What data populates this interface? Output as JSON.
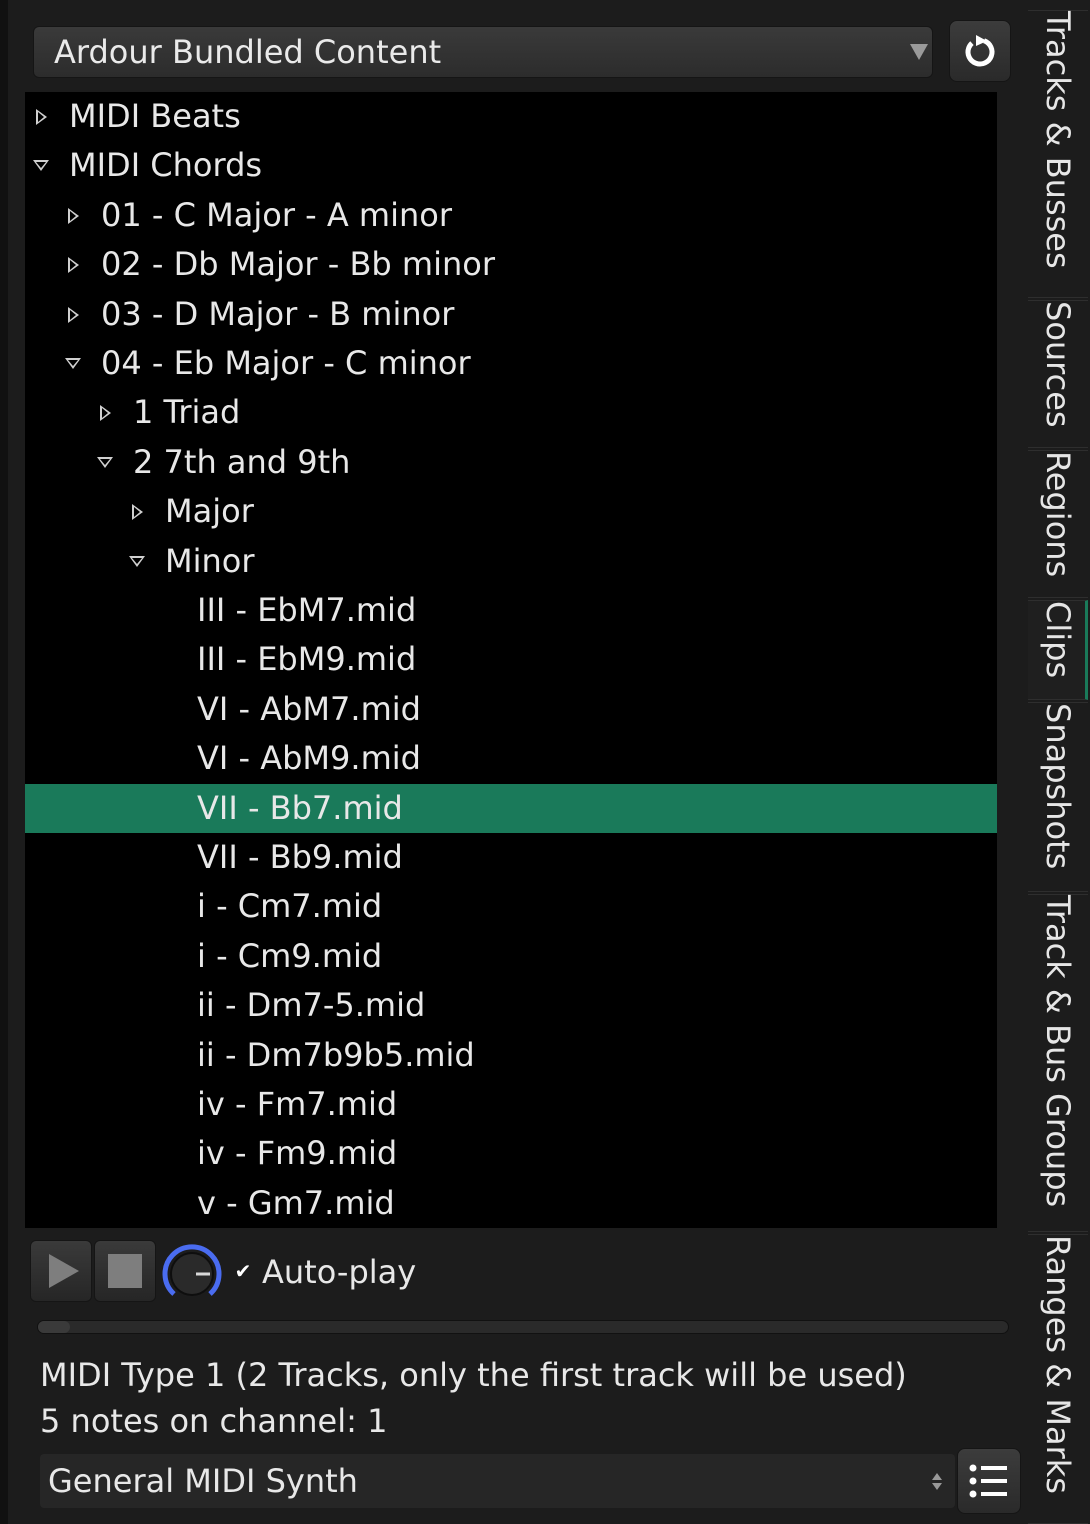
{
  "source_selector": {
    "value": "Ardour Bundled Content"
  },
  "tree": [
    {
      "label": "MIDI Beats",
      "level": 0,
      "expander": "collapsed"
    },
    {
      "label": "MIDI Chords",
      "level": 0,
      "expander": "expanded"
    },
    {
      "label": "01 - C Major - A minor",
      "level": 1,
      "expander": "collapsed"
    },
    {
      "label": "02 - Db Major - Bb minor",
      "level": 1,
      "expander": "collapsed"
    },
    {
      "label": "03 - D Major - B minor",
      "level": 1,
      "expander": "collapsed"
    },
    {
      "label": "04 - Eb Major - C minor",
      "level": 1,
      "expander": "expanded"
    },
    {
      "label": "1 Triad",
      "level": 2,
      "expander": "collapsed"
    },
    {
      "label": "2 7th and 9th",
      "level": 2,
      "expander": "expanded"
    },
    {
      "label": "Major",
      "level": 3,
      "expander": "collapsed"
    },
    {
      "label": "Minor",
      "level": 3,
      "expander": "expanded"
    },
    {
      "label": "III - EbM7.mid",
      "level": 4,
      "expander": "none"
    },
    {
      "label": "III - EbM9.mid",
      "level": 4,
      "expander": "none"
    },
    {
      "label": "VI - AbM7.mid",
      "level": 4,
      "expander": "none"
    },
    {
      "label": "VI - AbM9.mid",
      "level": 4,
      "expander": "none"
    },
    {
      "label": "VII - Bb7.mid",
      "level": 4,
      "expander": "none",
      "selected": true
    },
    {
      "label": "VII - Bb9.mid",
      "level": 4,
      "expander": "none"
    },
    {
      "label": "i - Cm7.mid",
      "level": 4,
      "expander": "none"
    },
    {
      "label": "i - Cm9.mid",
      "level": 4,
      "expander": "none"
    },
    {
      "label": "ii - Dm7-5.mid",
      "level": 4,
      "expander": "none"
    },
    {
      "label": "ii - Dm7b9b5.mid",
      "level": 4,
      "expander": "none"
    },
    {
      "label": "iv - Fm7.mid",
      "level": 4,
      "expander": "none"
    },
    {
      "label": "iv - Fm9.mid",
      "level": 4,
      "expander": "none"
    },
    {
      "label": "v - Gm7.mid",
      "level": 4,
      "expander": "none"
    }
  ],
  "transport": {
    "autoplay_label": "Auto-play",
    "autoplay_checked": true
  },
  "file_info": {
    "line1": "MIDI Type 1 (2 Tracks, only the first track will be used)",
    "line2": "5 notes on channel: 1"
  },
  "instrument": {
    "value": "General MIDI Synth"
  },
  "side_tabs": [
    {
      "label": "Tracks & Busses",
      "active": false
    },
    {
      "label": "Sources",
      "active": false
    },
    {
      "label": "Regions",
      "active": false
    },
    {
      "label": "Clips",
      "active": true
    },
    {
      "label": "Snapshots",
      "active": false
    },
    {
      "label": "Track & Bus Groups",
      "active": false
    },
    {
      "label": "Ranges & Marks",
      "active": false
    }
  ],
  "colors": {
    "selection": "#1a7a5a",
    "knob_arc": "#4a6cf0",
    "tree_background": "#000000",
    "panel_background": "#1c1c1c"
  },
  "icons": {
    "refresh": "refresh-icon",
    "play": "play-icon",
    "stop": "stop-icon",
    "knob": "volume-knob",
    "list": "list-icon"
  }
}
